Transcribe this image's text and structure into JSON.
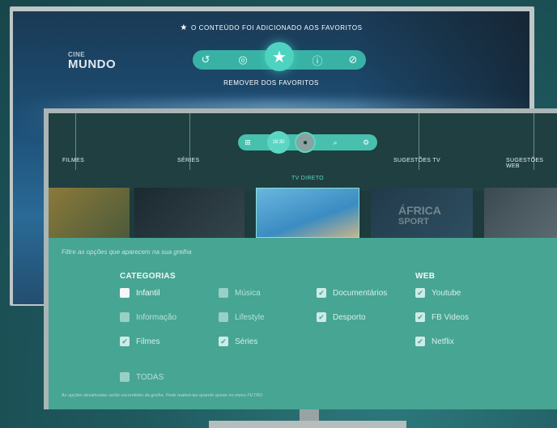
{
  "background_tv": {
    "logo_line1": "CINE",
    "logo_line2": "MUNDO",
    "favorite_message": "O CONTEÚDO FOI ADICIONADO AOS FAVORITOS",
    "controls": [
      "replay-icon",
      "target-icon",
      "star-icon",
      "info-icon",
      "hide-icon"
    ],
    "remove_label": "REMOVER DOS FAVORITOS"
  },
  "nav": {
    "filmes": "FILMES",
    "series": "SÉRIES",
    "sugestoes_tv": "SUGESTÕES TV",
    "sugestoes_web": "SUGESTÕES WEB",
    "tv_direto": "TV DIRETO",
    "center_time": "18:30"
  },
  "thumbs": {
    "africa": "ÁFRICA",
    "sport": "SPORT"
  },
  "filter": {
    "hint": "Filtre as opções que aparecem na sua grelha",
    "categorias_title": "CATEGORIAS",
    "web_title": "WEB",
    "options": {
      "infantil": "Infantil",
      "informacao": "Informação",
      "filmes": "Filmes",
      "todas": "TODAS",
      "musica": "Música",
      "lifestyle": "Lifestyle",
      "series": "Séries",
      "documentarios": "Documentários",
      "desporto": "Desporto",
      "youtube": "Youtube",
      "fb_videos": "FB Videos",
      "netflix": "Netflix"
    },
    "footnote": "As opções desativadas serão escondidas da grelha. Pode reativá-las quando quiser no menu FILTRO"
  },
  "colors": {
    "accent": "#48aa97",
    "pill": "#47c0ad",
    "highlight": "#5bd6c3"
  }
}
